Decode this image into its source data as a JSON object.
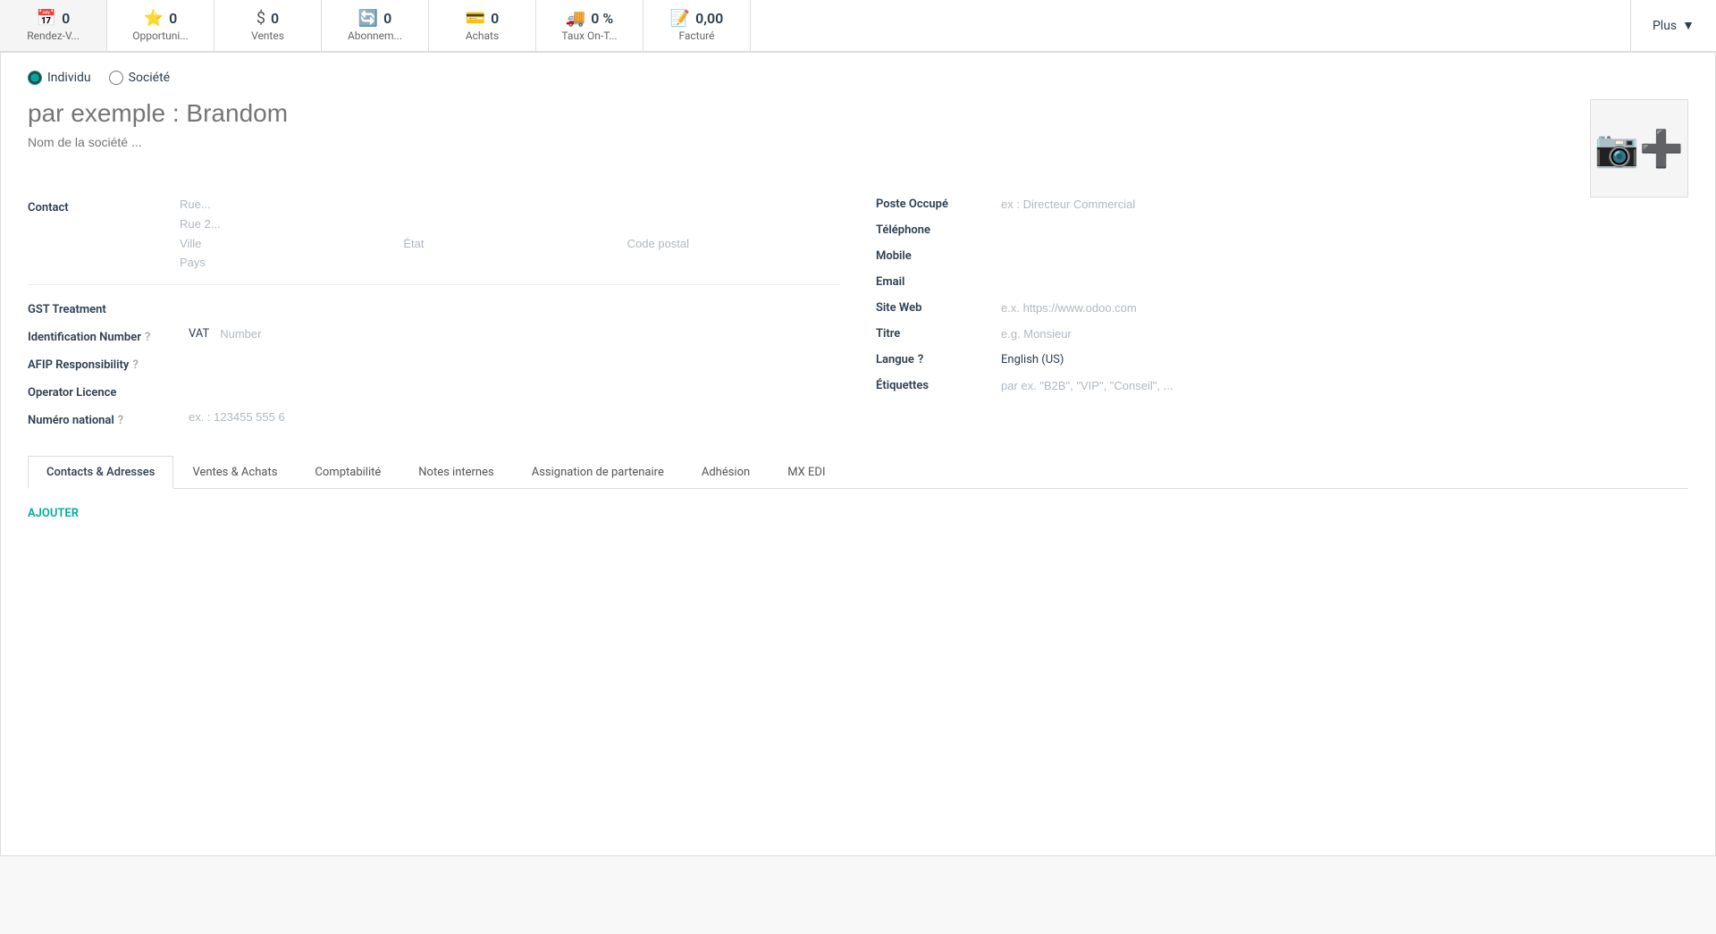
{
  "topbar": {
    "items": [
      {
        "id": "rendez-vous",
        "icon": "📅",
        "count": "0",
        "label": "Rendez-V..."
      },
      {
        "id": "opportunites",
        "icon": "⭐",
        "count": "0",
        "label": "Opportuni..."
      },
      {
        "id": "ventes",
        "icon": "$",
        "count": "0",
        "label": "Ventes"
      },
      {
        "id": "abonnements",
        "icon": "🔄",
        "count": "0",
        "label": "Abonnem..."
      },
      {
        "id": "achats",
        "icon": "💳",
        "count": "0",
        "label": "Achats"
      },
      {
        "id": "taux",
        "icon": "🚚",
        "count": "0 %",
        "label": "Taux On-T..."
      },
      {
        "id": "facture",
        "icon": "📝",
        "count": "0,00",
        "label": "Facturé"
      }
    ],
    "plus_label": "Plus"
  },
  "form": {
    "radio_individu": "Individu",
    "radio_societe": "Société",
    "name_placeholder": "par exemple : Brandom",
    "company_placeholder": "Nom de la société ...",
    "photo_alt": "Photo",
    "contact_label": "Contact",
    "address": {
      "rue_placeholder": "Rue...",
      "rue2_placeholder": "Rue 2...",
      "ville_placeholder": "Ville",
      "etat_placeholder": "État",
      "code_postal_placeholder": "Code postal",
      "pays_placeholder": "Pays"
    },
    "left_fields": [
      {
        "id": "gst-treatment",
        "label": "GST Treatment",
        "has_help": false,
        "value": "",
        "placeholder": ""
      },
      {
        "id": "identification-number",
        "label": "Identification Number",
        "has_help": true,
        "id_type": "VAT",
        "number_placeholder": "Number"
      },
      {
        "id": "afip-responsibility",
        "label": "AFIP Responsibility",
        "has_help": true,
        "value": "",
        "placeholder": ""
      },
      {
        "id": "operator-licence",
        "label": "Operator Licence",
        "has_help": false,
        "value": "",
        "placeholder": ""
      },
      {
        "id": "numero-national",
        "label": "Numéro national",
        "has_help": true,
        "value": "",
        "placeholder": "ex. : 123455 555 6"
      }
    ],
    "right_fields": [
      {
        "id": "poste-occupe",
        "label": "Poste Occupé",
        "has_help": false,
        "placeholder": "ex : Directeur Commercial"
      },
      {
        "id": "telephone",
        "label": "Téléphone",
        "has_help": false,
        "placeholder": ""
      },
      {
        "id": "mobile",
        "label": "Mobile",
        "has_help": false,
        "placeholder": ""
      },
      {
        "id": "email",
        "label": "Email",
        "has_help": false,
        "placeholder": ""
      },
      {
        "id": "site-web",
        "label": "Site Web",
        "has_help": false,
        "placeholder": "e.x. https://www.odoo.com"
      },
      {
        "id": "titre",
        "label": "Titre",
        "has_help": false,
        "placeholder": "e.g. Monsieur"
      },
      {
        "id": "langue",
        "label": "Langue",
        "has_help": true,
        "value": "English (US)",
        "placeholder": ""
      },
      {
        "id": "etiquettes",
        "label": "Étiquettes",
        "has_help": false,
        "placeholder": "par ex. \"B2B\", \"VIP\", \"Conseil\", ..."
      }
    ],
    "tabs": [
      {
        "id": "contacts-adresses",
        "label": "Contacts & Adresses",
        "active": true
      },
      {
        "id": "ventes-achats",
        "label": "Ventes & Achats",
        "active": false
      },
      {
        "id": "comptabilite",
        "label": "Comptabilité",
        "active": false
      },
      {
        "id": "notes-internes",
        "label": "Notes internes",
        "active": false
      },
      {
        "id": "assignation-partenaire",
        "label": "Assignation de partenaire",
        "active": false
      },
      {
        "id": "adhesion",
        "label": "Adhésion",
        "active": false
      },
      {
        "id": "mx-edi",
        "label": "MX EDI",
        "active": false
      }
    ],
    "ajouter_label": "AJOUTER"
  }
}
